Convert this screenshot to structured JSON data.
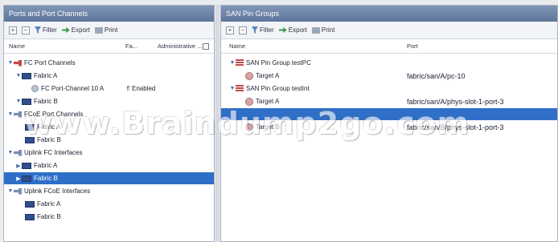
{
  "left_panel": {
    "title": "Ports and Port Channels",
    "toolbar": {
      "add": "+",
      "remove": "−",
      "filter": "Filter",
      "export": "Export",
      "print": "Print"
    },
    "columns": {
      "name": "Name",
      "fabric": "Fa...",
      "admin": "Administrative ..."
    },
    "rows": [
      {
        "label": "FC Port Channels",
        "icon": "plug-icon",
        "toggle": "▼"
      },
      {
        "label": "Fabric A",
        "icon": "folder-icon",
        "toggle": "▼"
      },
      {
        "label": "FC Port-Channel 10 A",
        "icon": "port-icon",
        "fabric": "⇑",
        "admin": "Enabled"
      },
      {
        "label": "Fabric B",
        "icon": "folder-icon",
        "toggle": "▼"
      },
      {
        "label": "FCoE Port Channels",
        "icon": "plug-icon",
        "toggle": "▼"
      },
      {
        "label": "Fabric A",
        "icon": "folder-icon"
      },
      {
        "label": "Fabric B",
        "icon": "folder-icon"
      },
      {
        "label": "Uplink FC Interfaces",
        "icon": "plug-icon",
        "toggle": "▼"
      },
      {
        "label": "Fabric A",
        "icon": "folder-icon",
        "toggle": "▶"
      },
      {
        "label": "Fabric B",
        "icon": "folder-icon",
        "toggle": "▶",
        "selected": true
      },
      {
        "label": "Uplink FCoE Interfaces",
        "icon": "plug-icon",
        "toggle": "▼"
      },
      {
        "label": "Fabric A",
        "icon": "folder-icon"
      },
      {
        "label": "Fabric B",
        "icon": "folder-icon"
      }
    ]
  },
  "right_panel": {
    "title": "SAN Pin Groups",
    "toolbar": {
      "add": "+",
      "remove": "−",
      "filter": "Filter",
      "export": "Export",
      "print": "Print"
    },
    "columns": {
      "name": "Name",
      "port": "Port"
    },
    "rows": [
      {
        "label": "SAN Pin Group testPC",
        "icon": "group-icon",
        "toggle": "▼"
      },
      {
        "label": "Target A",
        "icon": "target-icon",
        "port": "fabric/san/A/pc-10"
      },
      {
        "label": "SAN Pin Group testInt",
        "icon": "group-icon",
        "toggle": "▼"
      },
      {
        "label": "Target A",
        "icon": "target-icon",
        "port": "fabric/san/A/phys-slot-1-port-3"
      },
      {
        "label": "",
        "icon": "",
        "port": "",
        "selected": true
      },
      {
        "label": "Target B",
        "icon": "target-icon",
        "port": "fabric/san/B/phys-slot-1-port-3"
      }
    ]
  },
  "watermark": "www.Braindump2go.com",
  "colors": {
    "selection": "#2f6fc8",
    "titlebar": "#5d7599",
    "group_icon": "#c04848"
  }
}
